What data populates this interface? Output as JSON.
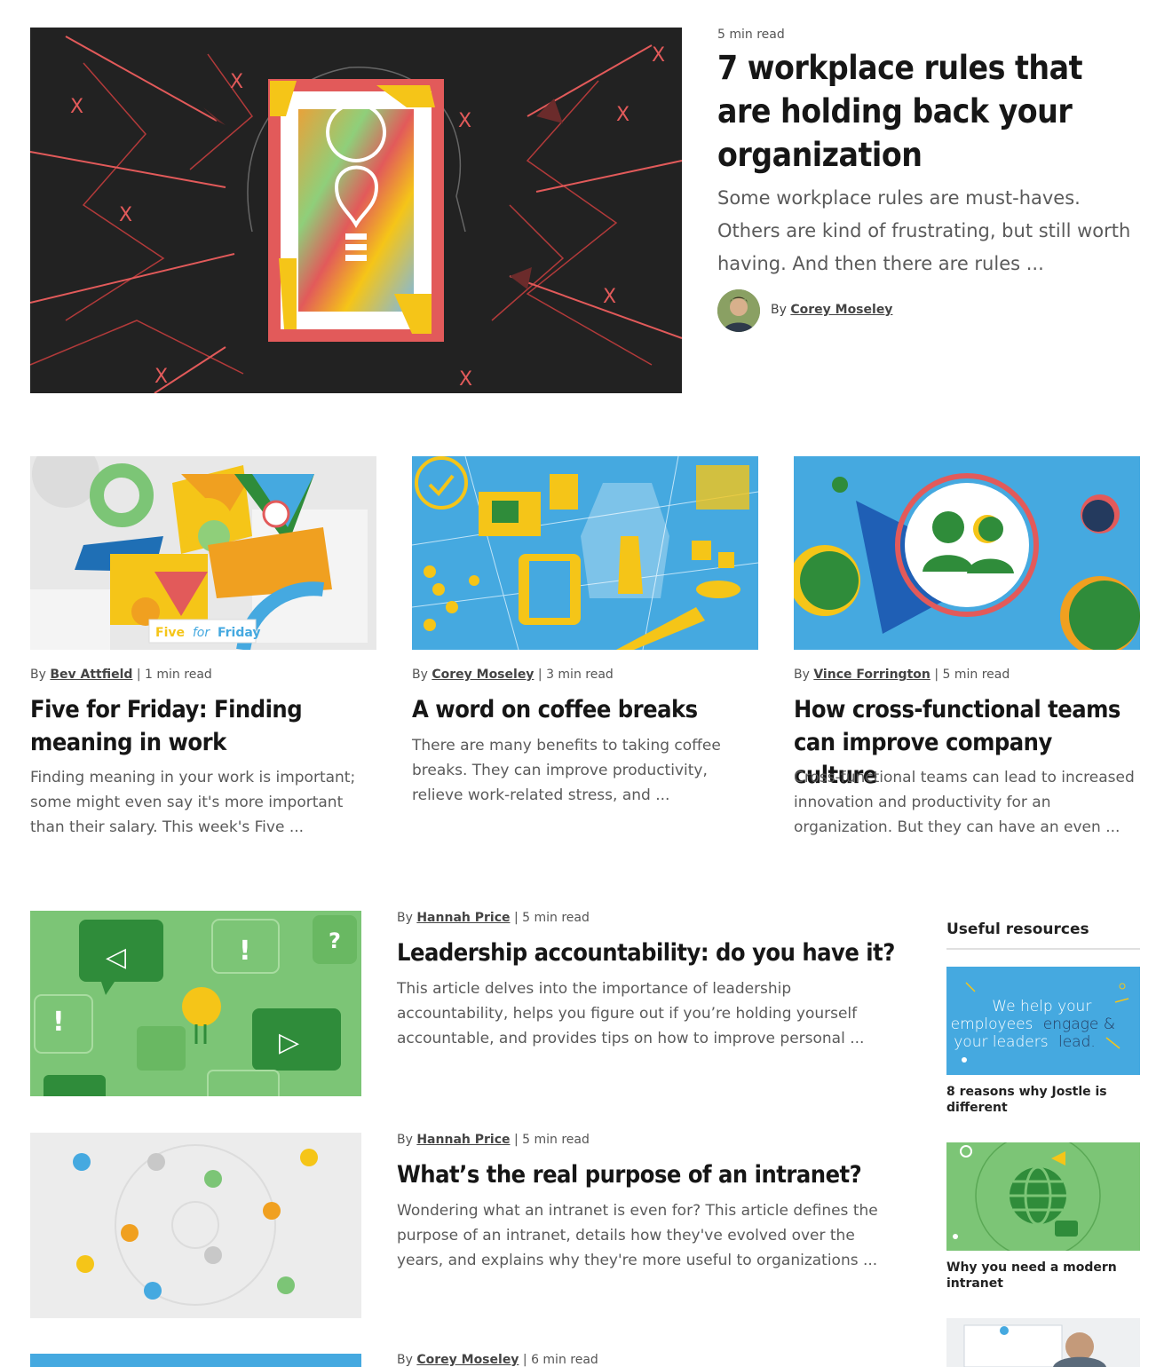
{
  "featured": {
    "read_time": "5 min read",
    "title": "7 workplace rules that are holding back your organization",
    "excerpt": "Some workplace rules are must-haves. Others are kind of frustrating, but still worth having. And then there are rules ...",
    "by": "By",
    "author": "Corey Moseley"
  },
  "grid": [
    {
      "by": "By",
      "author": "Bev Attfield",
      "read_time": "1 min read",
      "title": "Five for Friday: Finding meaning in work",
      "excerpt": "Finding meaning in your work is important; some might even say it's more important than their salary. This week's Five ...",
      "image_label_a": "Five",
      "image_label_b": "for",
      "image_label_c": "Friday"
    },
    {
      "by": "By",
      "author": "Corey Moseley",
      "read_time": "3 min read",
      "title": "A word on coffee breaks",
      "excerpt": "There are many benefits to taking coffee breaks. They can improve productivity, relieve work-related stress, and ..."
    },
    {
      "by": "By",
      "author": "Vince Forrington",
      "read_time": "5 min read",
      "title": "How cross-functional teams can improve company culture",
      "excerpt": "Cross-functional teams can lead to increased innovation and productivity for an organization. But they can have an even ..."
    }
  ],
  "list": [
    {
      "by": "By",
      "author": "Hannah Price",
      "read_time": "5 min read",
      "title": "Leadership accountability: do you have it?",
      "excerpt": "This article delves into the importance of leadership accountability, helps you figure out if you’re holding yourself accountable, and provides tips on how to improve personal ..."
    },
    {
      "by": "By",
      "author": "Hannah Price",
      "read_time": "5 min read",
      "title": "What’s the real purpose of an intranet?",
      "excerpt": "Wondering what an intranet is even for? This article defines the purpose of an intranet, details how they've evolved over the years, and explains why they're more useful to organizations ..."
    },
    {
      "by": "By",
      "author": "Corey Moseley",
      "read_time": "6 min read"
    }
  ],
  "sidebar": {
    "heading": "Useful resources",
    "items": [
      {
        "label": "8 reasons why Jostle is different",
        "image_line1": "We help your",
        "image_line2a": "employees",
        "image_line2b": "engage &",
        "image_line3a": "your leaders",
        "image_line3b": "lead."
      },
      {
        "label": "Why you need a modern intranet"
      }
    ]
  },
  "colors": {
    "dark_bg": "#222222",
    "accent_red": "#e25a5a",
    "yellow": "#f5c518",
    "blue": "#45a9e0",
    "green": "#7cc576",
    "light_grey": "#e8e8e8"
  }
}
